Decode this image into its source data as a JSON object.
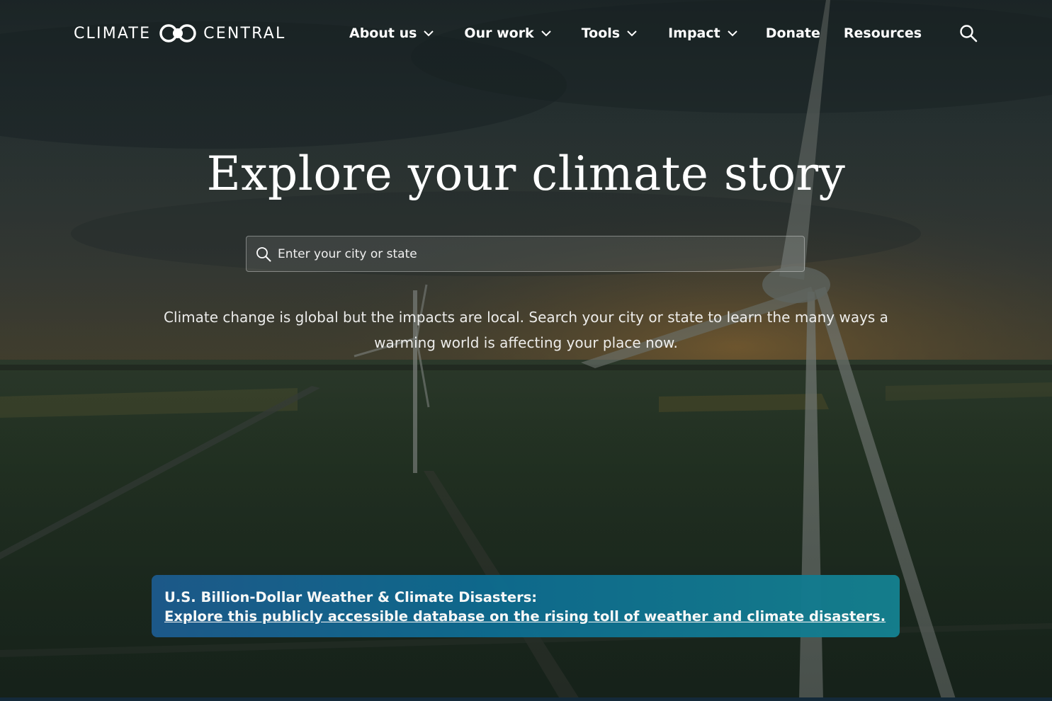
{
  "brand": {
    "name_left": "CLIMATE",
    "name_right": "CENTRAL",
    "logo_icon": "interlocking-circles-logo-mark"
  },
  "nav": {
    "items": [
      {
        "label": "About us",
        "has_dropdown": true
      },
      {
        "label": "Our work",
        "has_dropdown": true
      },
      {
        "label": "Tools",
        "has_dropdown": true
      },
      {
        "label": "Impact",
        "has_dropdown": true
      },
      {
        "label": "Donate",
        "has_dropdown": false
      },
      {
        "label": "Resources",
        "has_dropdown": false
      }
    ],
    "search_icon": "search-icon"
  },
  "hero": {
    "headline": "Explore your climate story",
    "search": {
      "placeholder": "Enter your city or state",
      "value": ""
    },
    "lede": "Climate change is global but the impacts are local. Search your city or state to learn the many ways a warming world is affecting your place now."
  },
  "banner": {
    "title": "U.S. Billion-Dollar Weather & Climate Disasters:",
    "link_text": "Explore this publicly accessible database on the rising toll of weather and climate disasters."
  },
  "colors": {
    "text": "#ffffff",
    "banner_start": "#1d5a8c",
    "banner_end": "#14808f",
    "overlay": "#1c2726"
  }
}
